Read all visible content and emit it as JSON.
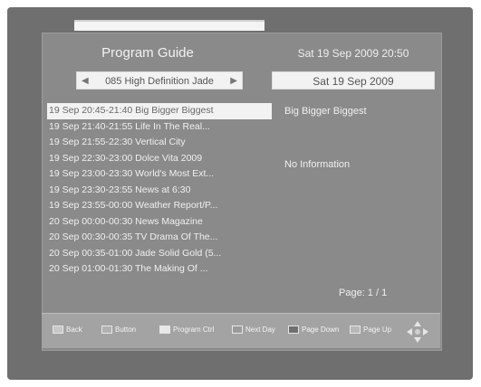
{
  "header": {
    "title": "Program Guide",
    "datetime": "Sat   19 Sep 2009 20:50"
  },
  "channel": {
    "name": "085 High Definition Jade",
    "left_arrow": "◀",
    "right_arrow": "▶"
  },
  "date_selector": "Sat   19 Sep 2009",
  "programs": [
    "19 Sep 20:45-21:40  Big Bigger Biggest",
    "19 Sep 21:40-21:55  Life In The Real...",
    "19 Sep 21:55-22:30  Vertical City",
    "19 Sep 22:30-23:00  Dolce Vita 2009",
    "19 Sep 23:00-23:30  World's Most Ext...",
    "19 Sep 23:30-23:55  News at 6:30",
    "19 Sep 23:55-00:00  Weather Report/P...",
    "20 Sep 00:00-00:30  News Magazine",
    "20 Sep 00:30-00:35  TV Drama Of The...",
    "20 Sep 00:35-01:00  Jade Solid Gold (5...",
    "20 Sep 01:00-01:30  The Making Of ..."
  ],
  "detail": {
    "title": "Big Bigger Biggest",
    "info": "No Information"
  },
  "page_indicator": "Page: 1 / 1",
  "legend": [
    {
      "label": "Back",
      "color": "#c8c8c8"
    },
    {
      "label": "Button",
      "color": "#b0b0b0"
    },
    {
      "label": "Program Ctrl",
      "color": "#e8e8e8"
    },
    {
      "label": "Next Day",
      "color": "#9a9a9a"
    },
    {
      "label": "Page Down",
      "color": "#707070"
    },
    {
      "label": "Page Up",
      "color": "#b8b8b8"
    }
  ],
  "colors": {
    "selected_row_bg": "#f2f2f2",
    "screen_bg": "#8a8a8a"
  }
}
